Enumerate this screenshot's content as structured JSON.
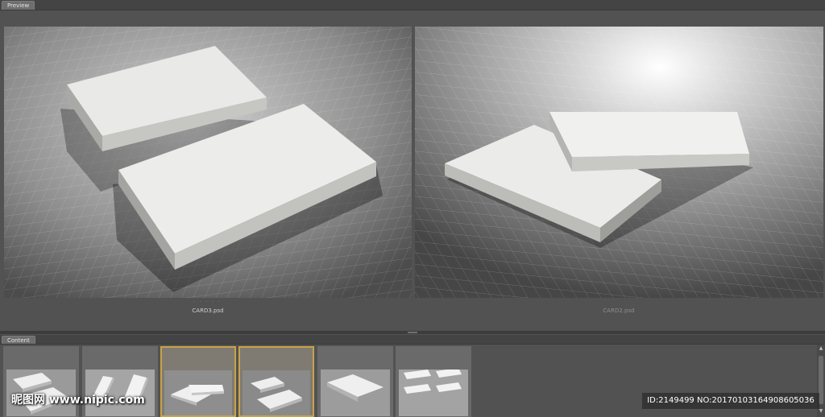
{
  "preview_panel": {
    "tab_label": "Preview",
    "items": [
      {
        "caption": "CARD3.psd",
        "state": "active"
      },
      {
        "caption": "CARD2.psd",
        "state": "inactive"
      }
    ],
    "page_indicator": "· · · · ·"
  },
  "content_panel": {
    "tab_label": "Content",
    "thumbnails": [
      {
        "id": "thumb-1",
        "selected": false
      },
      {
        "id": "thumb-2",
        "selected": false
      },
      {
        "id": "thumb-3",
        "selected": true
      },
      {
        "id": "thumb-4",
        "selected": true
      },
      {
        "id": "thumb-5",
        "selected": false
      },
      {
        "id": "thumb-6",
        "selected": false
      }
    ]
  },
  "watermark": {
    "site": "昵图网 www.nipic.com",
    "id_text": "ID:2149499 NO:20170103164908605036"
  },
  "colors": {
    "panel_bg": "#525252",
    "selection_border": "#c9a24a",
    "tab_bg": "#6e6e6e"
  },
  "icons": {
    "scroll_up": "▲",
    "scroll_down": "▼"
  }
}
